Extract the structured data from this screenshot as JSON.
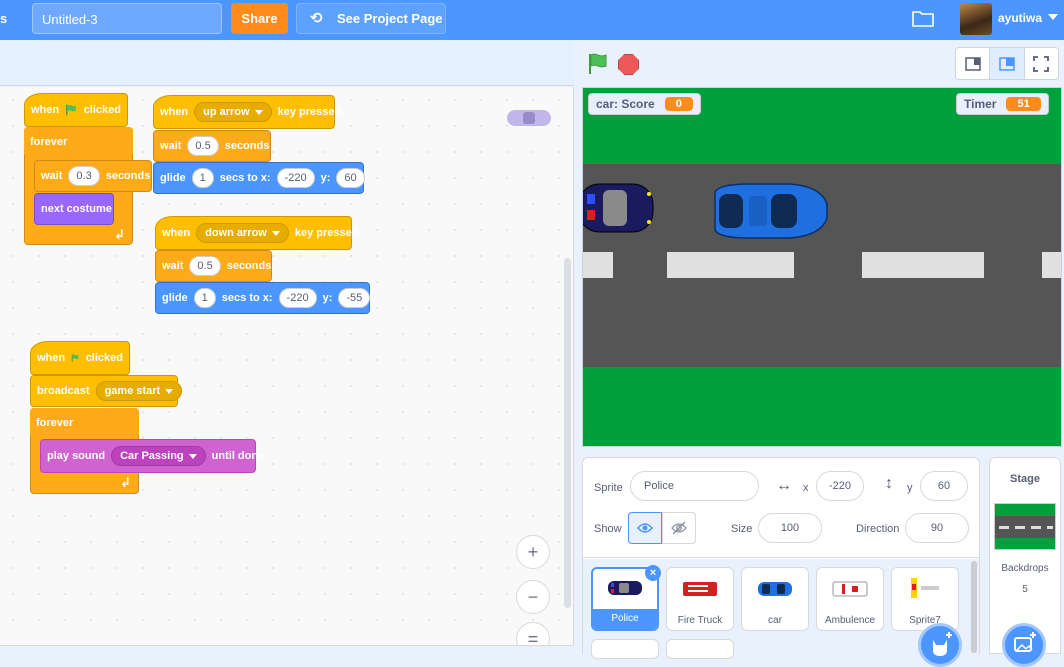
{
  "menubar": {
    "edge_text": "s",
    "project_title": "Untitled-3",
    "share_label": "Share",
    "see_project_label": "See Project Page",
    "username": "ayutiwa"
  },
  "scripts": {
    "s1": {
      "when": "when",
      "clicked": "clicked",
      "forever": "forever",
      "wait": "wait",
      "wait_val": "0.3",
      "seconds": "seconds",
      "next_costume": "next costume"
    },
    "s2": {
      "when": "when",
      "key": "up arrow",
      "key_pressed": "key pressed",
      "wait": "wait",
      "wait_val": "0.5",
      "seconds": "seconds",
      "glide": "glide",
      "glide_secs": "1",
      "secs_to_x": "secs to x:",
      "x": "-220",
      "y_label": "y:",
      "y": "60"
    },
    "s3": {
      "when": "when",
      "key": "down arrow",
      "key_pressed": "key pressed",
      "wait": "wait",
      "wait_val": "0.5",
      "seconds": "seconds",
      "glide": "glide",
      "glide_secs": "1",
      "secs_to_x": "secs to x:",
      "x": "-220",
      "y_label": "y:",
      "y": "-55"
    },
    "s4": {
      "when": "when",
      "clicked": "clicked",
      "broadcast": "broadcast",
      "message": "game start",
      "forever": "forever",
      "play_sound": "play sound",
      "sound": "Car Passing",
      "until_done": "until done"
    }
  },
  "zoom": {
    "in": "+",
    "out": "−",
    "reset": "="
  },
  "stage": {
    "score_label": "car: Score",
    "score_value": "0",
    "timer_label": "Timer",
    "timer_value": "51"
  },
  "sprite_info": {
    "sprite_label": "Sprite",
    "sprite_name": "Police",
    "x_label": "x",
    "x_value": "-220",
    "y_label": "y",
    "y_value": "60",
    "show_label": "Show",
    "size_label": "Size",
    "size_value": "100",
    "direction_label": "Direction",
    "direction_value": "90"
  },
  "sprites": [
    {
      "name": "Police"
    },
    {
      "name": "Fire Truck"
    },
    {
      "name": "car"
    },
    {
      "name": "Ambulence"
    },
    {
      "name": "Sprite7"
    }
  ],
  "stage_pane": {
    "title": "Stage",
    "backdrops_label": "Backdrops",
    "backdrops_count": "5"
  },
  "colors": {
    "menubar": "#4c97ff",
    "events": "#ffbf00",
    "control": "#ffab19",
    "motion": "#4c97ff",
    "looks": "#9966ff",
    "sound": "#cf63cf",
    "stage_grass": "#00a03c",
    "road": "#555555"
  }
}
